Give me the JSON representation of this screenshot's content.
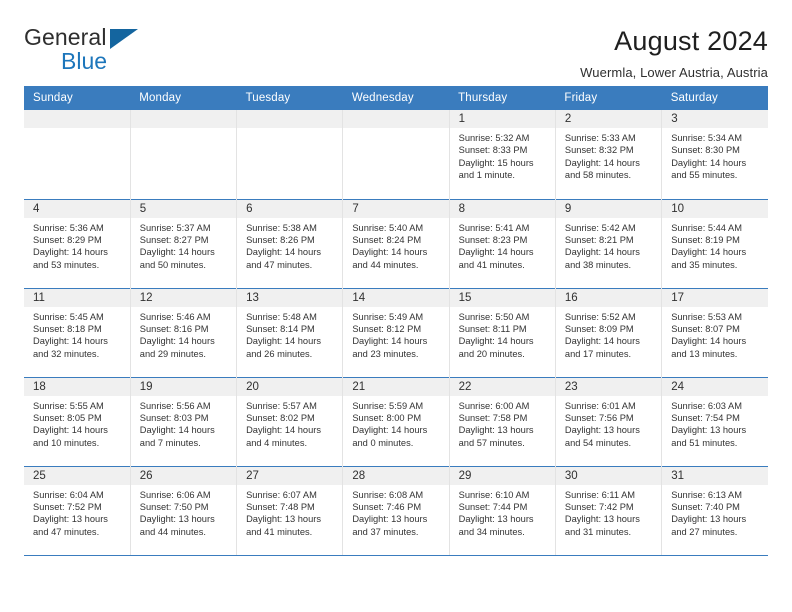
{
  "logo": {
    "word_one": "General",
    "word_two": "Blue",
    "triangle": "blue-triangle-icon"
  },
  "header": {
    "title": "August 2024",
    "subtitle": "Wuermla, Lower Austria, Austria"
  },
  "colors": {
    "header_blue": "#3a7cbe",
    "logo_blue": "#1d76bb",
    "daynum_bg": "#f0f0f0",
    "cell_border": "#e3e3e3"
  },
  "weekdays": [
    "Sunday",
    "Monday",
    "Tuesday",
    "Wednesday",
    "Thursday",
    "Friday",
    "Saturday"
  ],
  "weeks": [
    [
      {
        "day": "",
        "lines": []
      },
      {
        "day": "",
        "lines": []
      },
      {
        "day": "",
        "lines": []
      },
      {
        "day": "",
        "lines": []
      },
      {
        "day": "1",
        "lines": [
          "Sunrise: 5:32 AM",
          "Sunset: 8:33 PM",
          "Daylight: 15 hours",
          "and 1 minute."
        ]
      },
      {
        "day": "2",
        "lines": [
          "Sunrise: 5:33 AM",
          "Sunset: 8:32 PM",
          "Daylight: 14 hours",
          "and 58 minutes."
        ]
      },
      {
        "day": "3",
        "lines": [
          "Sunrise: 5:34 AM",
          "Sunset: 8:30 PM",
          "Daylight: 14 hours",
          "and 55 minutes."
        ]
      }
    ],
    [
      {
        "day": "4",
        "lines": [
          "Sunrise: 5:36 AM",
          "Sunset: 8:29 PM",
          "Daylight: 14 hours",
          "and 53 minutes."
        ]
      },
      {
        "day": "5",
        "lines": [
          "Sunrise: 5:37 AM",
          "Sunset: 8:27 PM",
          "Daylight: 14 hours",
          "and 50 minutes."
        ]
      },
      {
        "day": "6",
        "lines": [
          "Sunrise: 5:38 AM",
          "Sunset: 8:26 PM",
          "Daylight: 14 hours",
          "and 47 minutes."
        ]
      },
      {
        "day": "7",
        "lines": [
          "Sunrise: 5:40 AM",
          "Sunset: 8:24 PM",
          "Daylight: 14 hours",
          "and 44 minutes."
        ]
      },
      {
        "day": "8",
        "lines": [
          "Sunrise: 5:41 AM",
          "Sunset: 8:23 PM",
          "Daylight: 14 hours",
          "and 41 minutes."
        ]
      },
      {
        "day": "9",
        "lines": [
          "Sunrise: 5:42 AM",
          "Sunset: 8:21 PM",
          "Daylight: 14 hours",
          "and 38 minutes."
        ]
      },
      {
        "day": "10",
        "lines": [
          "Sunrise: 5:44 AM",
          "Sunset: 8:19 PM",
          "Daylight: 14 hours",
          "and 35 minutes."
        ]
      }
    ],
    [
      {
        "day": "11",
        "lines": [
          "Sunrise: 5:45 AM",
          "Sunset: 8:18 PM",
          "Daylight: 14 hours",
          "and 32 minutes."
        ]
      },
      {
        "day": "12",
        "lines": [
          "Sunrise: 5:46 AM",
          "Sunset: 8:16 PM",
          "Daylight: 14 hours",
          "and 29 minutes."
        ]
      },
      {
        "day": "13",
        "lines": [
          "Sunrise: 5:48 AM",
          "Sunset: 8:14 PM",
          "Daylight: 14 hours",
          "and 26 minutes."
        ]
      },
      {
        "day": "14",
        "lines": [
          "Sunrise: 5:49 AM",
          "Sunset: 8:12 PM",
          "Daylight: 14 hours",
          "and 23 minutes."
        ]
      },
      {
        "day": "15",
        "lines": [
          "Sunrise: 5:50 AM",
          "Sunset: 8:11 PM",
          "Daylight: 14 hours",
          "and 20 minutes."
        ]
      },
      {
        "day": "16",
        "lines": [
          "Sunrise: 5:52 AM",
          "Sunset: 8:09 PM",
          "Daylight: 14 hours",
          "and 17 minutes."
        ]
      },
      {
        "day": "17",
        "lines": [
          "Sunrise: 5:53 AM",
          "Sunset: 8:07 PM",
          "Daylight: 14 hours",
          "and 13 minutes."
        ]
      }
    ],
    [
      {
        "day": "18",
        "lines": [
          "Sunrise: 5:55 AM",
          "Sunset: 8:05 PM",
          "Daylight: 14 hours",
          "and 10 minutes."
        ]
      },
      {
        "day": "19",
        "lines": [
          "Sunrise: 5:56 AM",
          "Sunset: 8:03 PM",
          "Daylight: 14 hours",
          "and 7 minutes."
        ]
      },
      {
        "day": "20",
        "lines": [
          "Sunrise: 5:57 AM",
          "Sunset: 8:02 PM",
          "Daylight: 14 hours",
          "and 4 minutes."
        ]
      },
      {
        "day": "21",
        "lines": [
          "Sunrise: 5:59 AM",
          "Sunset: 8:00 PM",
          "Daylight: 14 hours",
          "and 0 minutes."
        ]
      },
      {
        "day": "22",
        "lines": [
          "Sunrise: 6:00 AM",
          "Sunset: 7:58 PM",
          "Daylight: 13 hours",
          "and 57 minutes."
        ]
      },
      {
        "day": "23",
        "lines": [
          "Sunrise: 6:01 AM",
          "Sunset: 7:56 PM",
          "Daylight: 13 hours",
          "and 54 minutes."
        ]
      },
      {
        "day": "24",
        "lines": [
          "Sunrise: 6:03 AM",
          "Sunset: 7:54 PM",
          "Daylight: 13 hours",
          "and 51 minutes."
        ]
      }
    ],
    [
      {
        "day": "25",
        "lines": [
          "Sunrise: 6:04 AM",
          "Sunset: 7:52 PM",
          "Daylight: 13 hours",
          "and 47 minutes."
        ]
      },
      {
        "day": "26",
        "lines": [
          "Sunrise: 6:06 AM",
          "Sunset: 7:50 PM",
          "Daylight: 13 hours",
          "and 44 minutes."
        ]
      },
      {
        "day": "27",
        "lines": [
          "Sunrise: 6:07 AM",
          "Sunset: 7:48 PM",
          "Daylight: 13 hours",
          "and 41 minutes."
        ]
      },
      {
        "day": "28",
        "lines": [
          "Sunrise: 6:08 AM",
          "Sunset: 7:46 PM",
          "Daylight: 13 hours",
          "and 37 minutes."
        ]
      },
      {
        "day": "29",
        "lines": [
          "Sunrise: 6:10 AM",
          "Sunset: 7:44 PM",
          "Daylight: 13 hours",
          "and 34 minutes."
        ]
      },
      {
        "day": "30",
        "lines": [
          "Sunrise: 6:11 AM",
          "Sunset: 7:42 PM",
          "Daylight: 13 hours",
          "and 31 minutes."
        ]
      },
      {
        "day": "31",
        "lines": [
          "Sunrise: 6:13 AM",
          "Sunset: 7:40 PM",
          "Daylight: 13 hours",
          "and 27 minutes."
        ]
      }
    ]
  ]
}
